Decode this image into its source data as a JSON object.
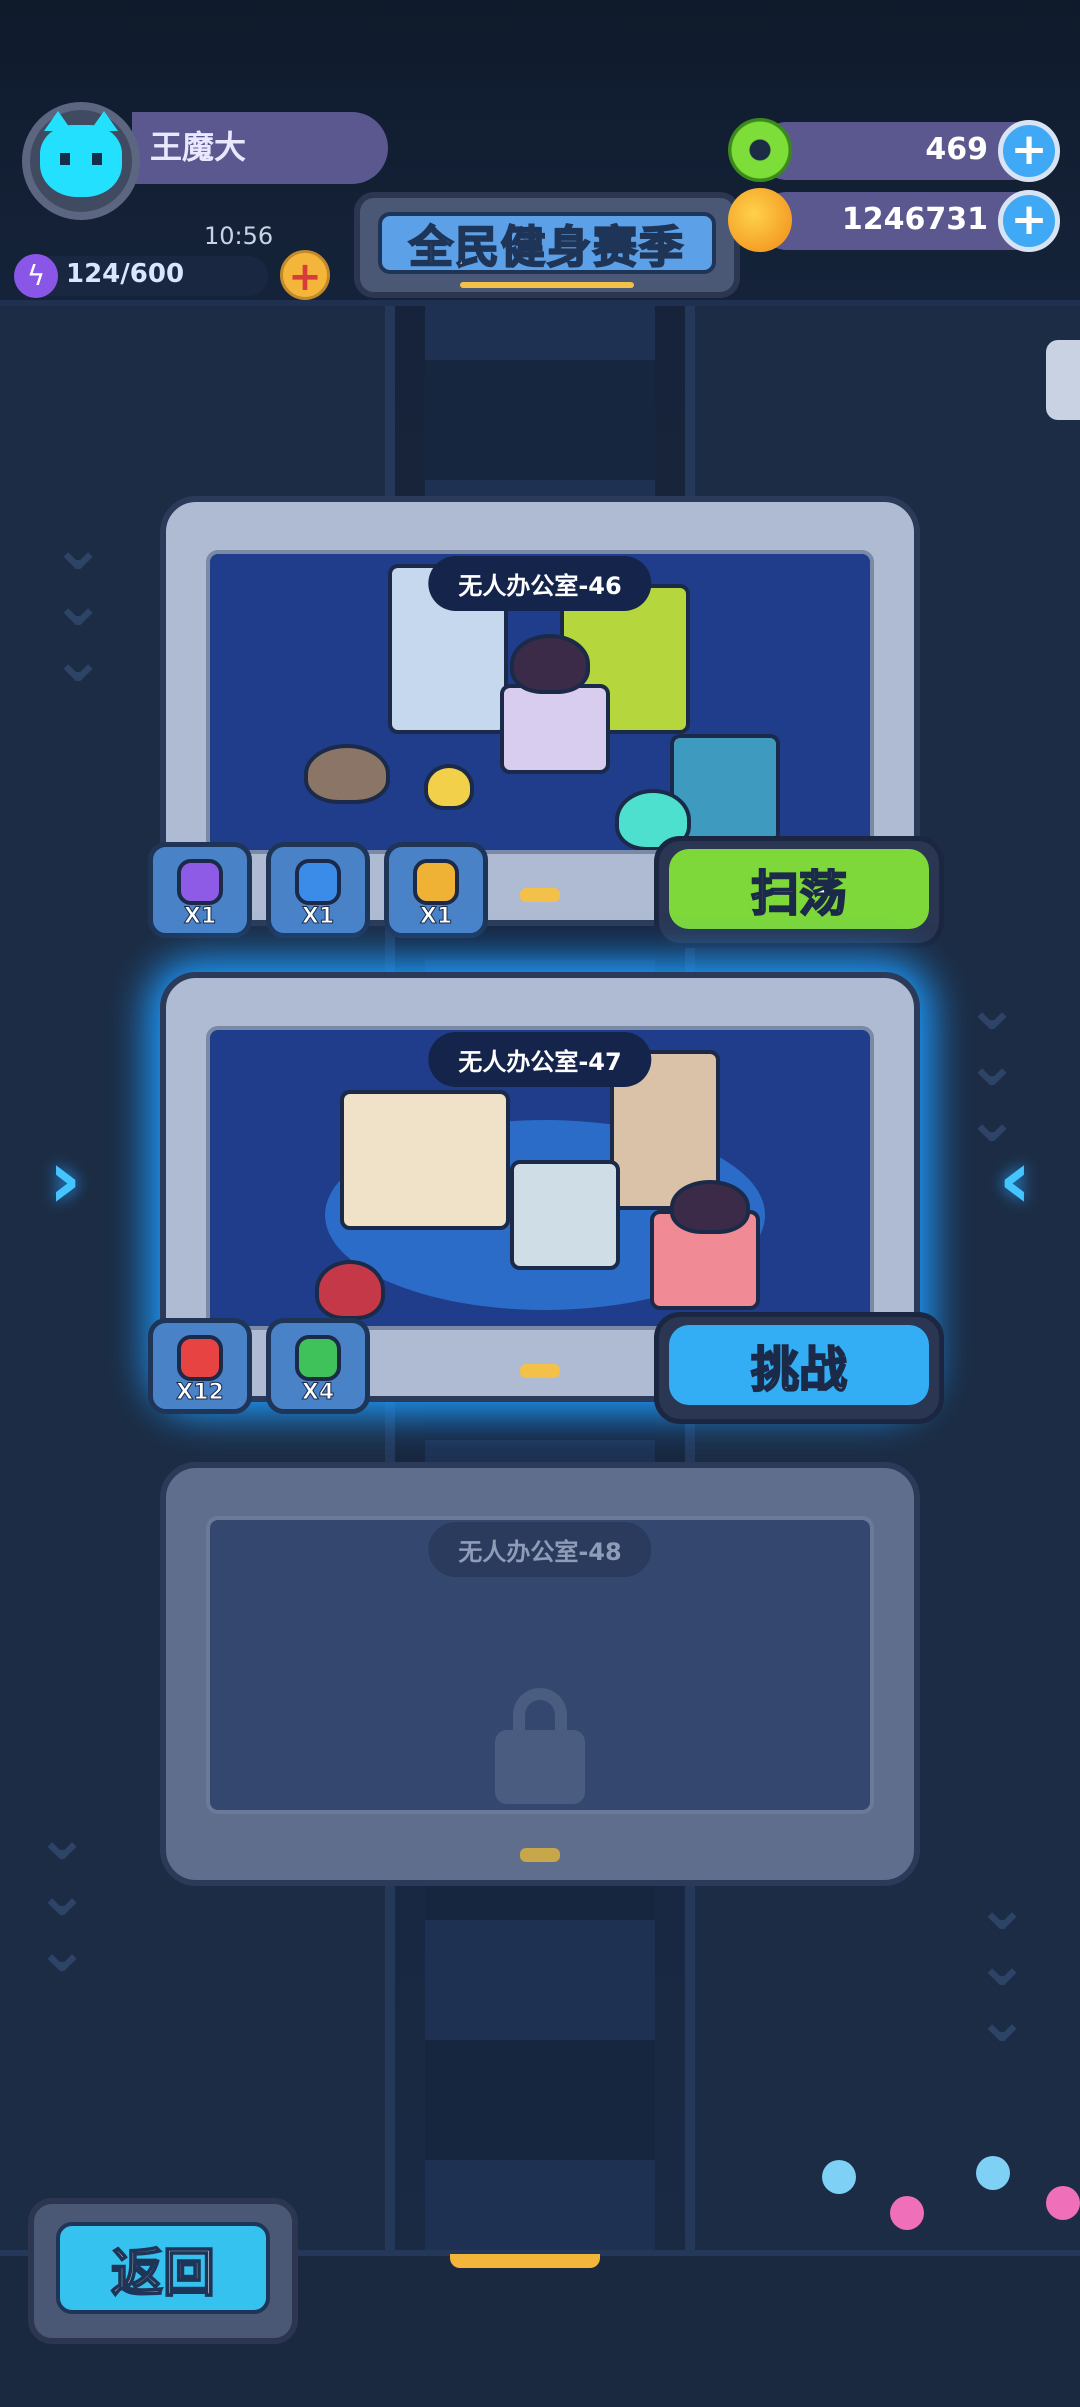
{
  "player": {
    "name": "王魔大",
    "clock": "10:56"
  },
  "energy": {
    "text": "124/600",
    "icon": "lightning-icon"
  },
  "season": {
    "label": "全民健身赛季"
  },
  "currencies": [
    {
      "name": "donut",
      "icon": "donut-icon",
      "value": "469"
    },
    {
      "name": "planet",
      "icon": "planet-coin-icon",
      "value": "1246731"
    }
  ],
  "levels": [
    {
      "title": "无人办公室-46",
      "state": "cleared",
      "rewards": [
        {
          "icon": "purple-gem-icon",
          "color": "#8e5be6",
          "qty": "X1"
        },
        {
          "icon": "blue-gem-icon",
          "color": "#3b8ce8",
          "qty": "X1"
        },
        {
          "icon": "gold-gem-icon",
          "color": "#f0b234",
          "qty": "X1"
        }
      ],
      "action": "扫荡"
    },
    {
      "title": "无人办公室-47",
      "state": "current",
      "rewards": [
        {
          "icon": "red-gem-icon",
          "color": "#e84343",
          "qty": "X12"
        },
        {
          "icon": "green-gem-icon",
          "color": "#3fc25a",
          "qty": "X4"
        }
      ],
      "action": "挑战"
    },
    {
      "title": "无人办公室-48",
      "state": "locked"
    }
  ],
  "back": {
    "label": "返回"
  },
  "colors": {
    "accent": "#33aef5",
    "sweep": "#7ed83a",
    "panel": "#5b5890"
  }
}
